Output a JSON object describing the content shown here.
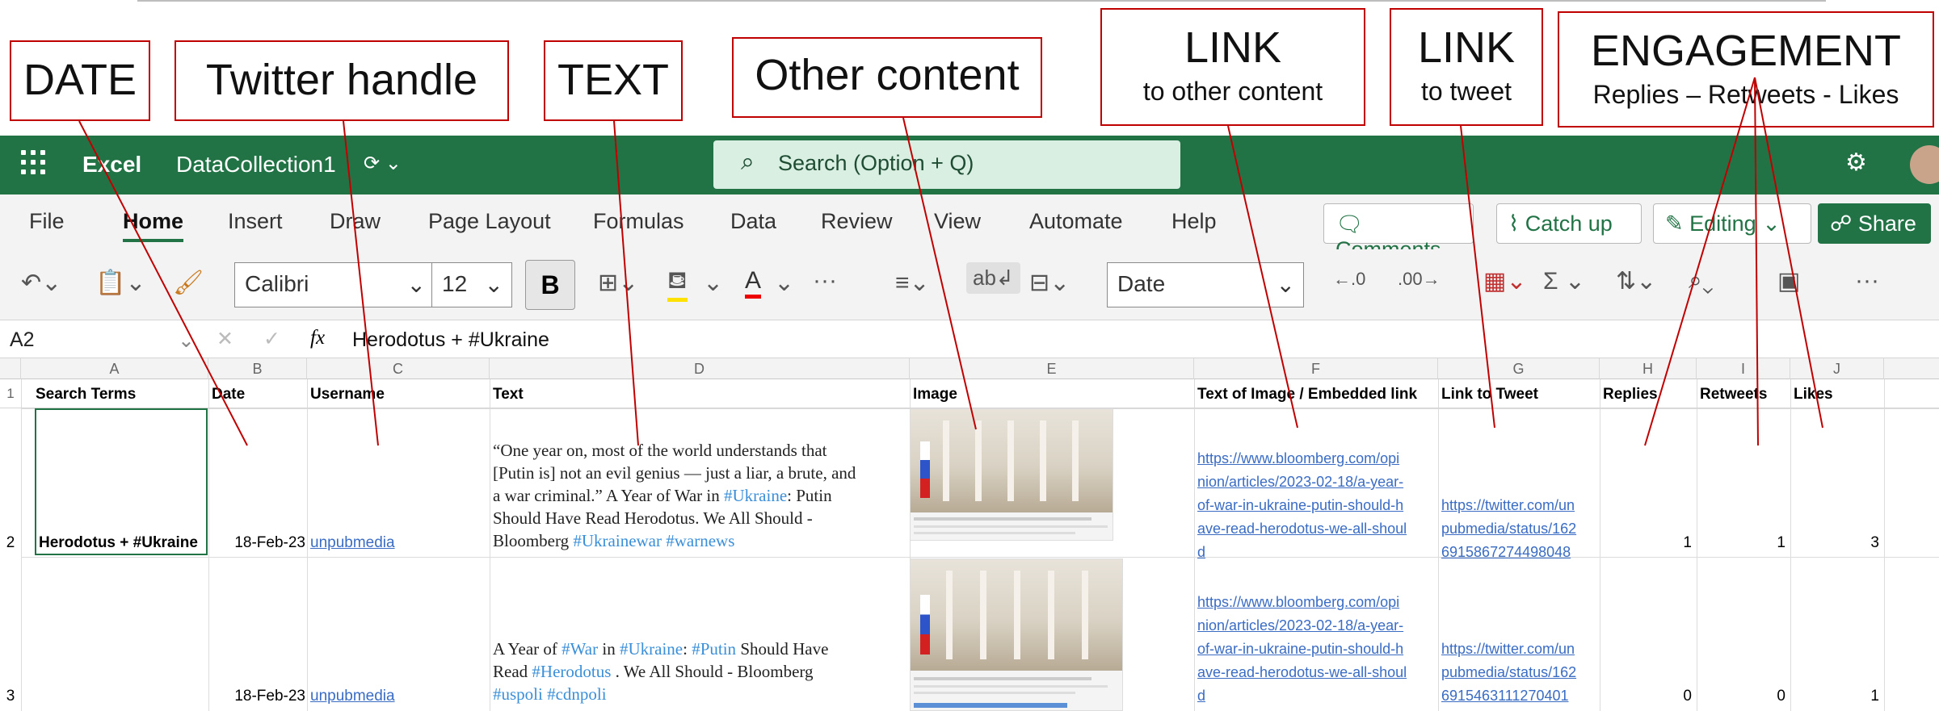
{
  "callouts": {
    "date": "DATE",
    "handle": "Twitter handle",
    "text": "TEXT",
    "other": "Other content",
    "link1_big": "LINK",
    "link1_small": "to other content",
    "link2_big": "LINK",
    "link2_small": "to tweet",
    "eng_big": "ENGAGEMENT",
    "eng_small": "Replies – Retweets - Likes"
  },
  "titlebar": {
    "app": "Excel",
    "file": "DataCollection1",
    "search": "Search (Option + Q)"
  },
  "tabs": [
    "File",
    "Home",
    "Insert",
    "Draw",
    "Page Layout",
    "Formulas",
    "Data",
    "Review",
    "View",
    "Automate",
    "Help"
  ],
  "ribbon_buttons": {
    "comments": "Comments",
    "catchup": "Catch up",
    "editing": "Editing",
    "share": "Share"
  },
  "toolbar": {
    "font": "Calibri",
    "size": "12",
    "bold": "B",
    "format": "Date",
    "ellipsis": "···"
  },
  "formula_bar": {
    "cell_ref": "A2",
    "fx": "fx",
    "content": "Herodotus + #Ukraine"
  },
  "columns": [
    "A",
    "B",
    "C",
    "D",
    "E",
    "F",
    "G",
    "H",
    "I",
    "J"
  ],
  "headers": [
    "Search Terms",
    "Date",
    "Username",
    "Text",
    "Image",
    "Text of Image / Embedded link",
    "Link to Tweet",
    "Replies",
    "Retweets",
    "Likes"
  ],
  "rows": [
    {
      "num": "2",
      "search": "Herodotus + #Ukraine",
      "date": "18-Feb-23",
      "user": "unpubmedia",
      "text_lines": [
        "“One year on, most of the world understands that",
        "[Putin is] not an evil genius — just a liar, a brute, and",
        "a war criminal.” A Year of War in #Ukraine: Putin",
        "Should Have Read Herodotus. We All Should -",
        "Bloomberg #Ukrainewar #warnews"
      ],
      "embed_lines": [
        "https://www.bloomberg.com/opi",
        "nion/articles/2023-02-18/a-year-",
        "of-war-in-ukraine-putin-should-h",
        "ave-read-herodotus-we-all-shoul",
        "d"
      ],
      "tweet_lines": [
        "https://twitter.com/un",
        "pubmedia/status/162",
        "6915867274498048"
      ],
      "replies": "1",
      "retweets": "1",
      "likes": "3"
    },
    {
      "num": "3",
      "search": "",
      "date": "18-Feb-23",
      "user": "unpubmedia",
      "text_lines": [
        "A Year of #War in #Ukraine: #Putin Should Have",
        "Read #Herodotus . We All Should - Bloomberg",
        "#uspoli #cdnpoli"
      ],
      "embed_lines": [
        "https://www.bloomberg.com/opi",
        "nion/articles/2023-02-18/a-year-",
        "of-war-in-ukraine-putin-should-h",
        "ave-read-herodotus-we-all-shoul",
        "d"
      ],
      "tweet_lines": [
        "https://twitter.com/un",
        "pubmedia/status/162",
        "6915463111270401"
      ],
      "replies": "0",
      "retweets": "0",
      "likes": "1"
    }
  ],
  "row1_num": "1",
  "colors": {
    "excel_green": "#217346",
    "callout_border": "#c00000",
    "link": "#3a6cc4"
  }
}
